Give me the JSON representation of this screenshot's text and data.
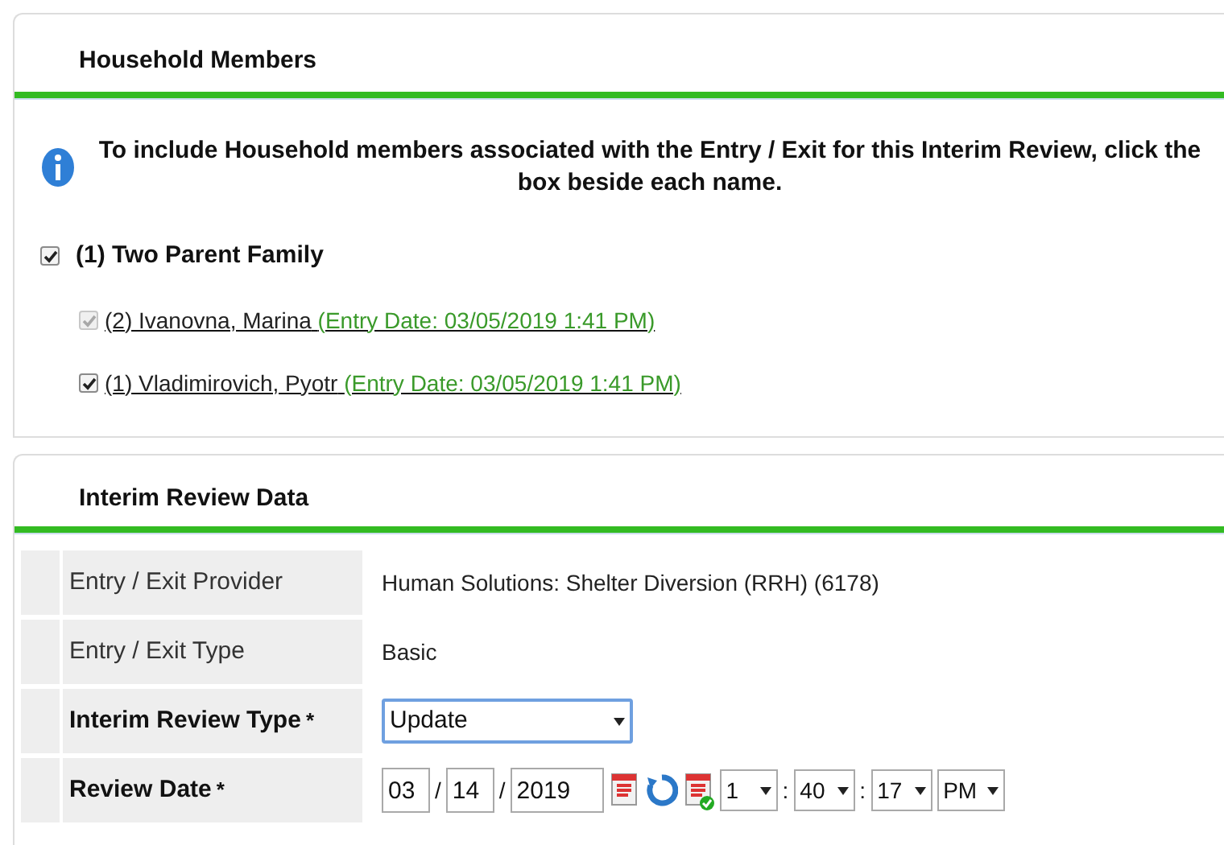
{
  "household": {
    "title": "Household Members",
    "info": "To include Household members associated with the Entry / Exit for this Interim Review, click the box beside each name.",
    "family": {
      "label": "(1) Two Parent Family",
      "checked": true
    },
    "members": [
      {
        "name": "(2) Ivanovna, Marina",
        "entry": "(Entry Date: 03/05/2019 1:41 PM)",
        "checked": true,
        "disabled": true
      },
      {
        "name": "(1) Vladimirovich, Pyotr",
        "entry": "(Entry Date: 03/05/2019 1:41 PM)",
        "checked": true,
        "disabled": false
      }
    ]
  },
  "review": {
    "title": "Interim Review Data",
    "rows": [
      {
        "kind": "text",
        "label": "Entry / Exit Provider",
        "required": false,
        "value": "Human Solutions: Shelter Diversion (RRH) (6178)"
      },
      {
        "kind": "text",
        "label": "Entry / Exit Type",
        "required": false,
        "value": "Basic"
      },
      {
        "kind": "select",
        "label": "Interim Review Type",
        "required": true,
        "asterisk": "*",
        "value": "Update"
      },
      {
        "kind": "date",
        "label": "Review Date",
        "required": true,
        "asterisk": "*",
        "month": "03",
        "sep1": "/",
        "day": "14",
        "sep2": "/",
        "year": "2019",
        "hour": "1",
        "colon1": ":",
        "minute": "40",
        "colon2": ":",
        "second": "17",
        "ampm": "PM"
      }
    ]
  }
}
